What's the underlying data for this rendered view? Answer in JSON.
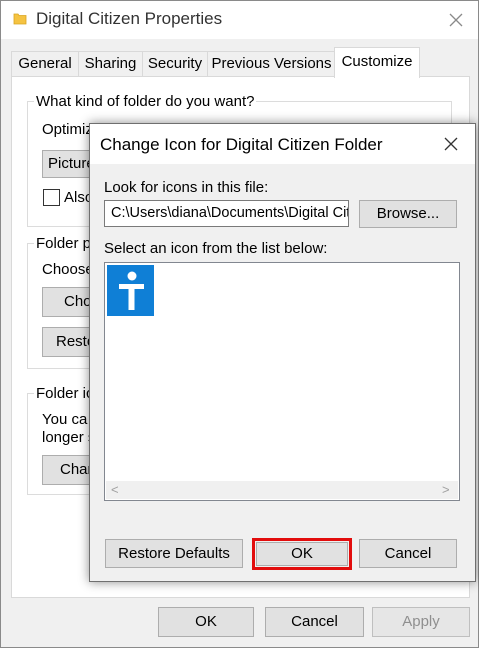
{
  "main_window": {
    "title": "Digital Citizen Properties",
    "close_glyph": "✕",
    "tabs": [
      {
        "label": "General"
      },
      {
        "label": "Sharing"
      },
      {
        "label": "Security"
      },
      {
        "label": "Previous Versions"
      },
      {
        "label": "Customize",
        "active": true
      }
    ],
    "customize": {
      "folder_kind_group": "What kind of folder do you want?",
      "optimize_label": "Optimiz",
      "optimize_value": "Picture",
      "also_label": "Also",
      "folder_pictures_group": "Folder pi",
      "choose_label": "Choose",
      "choose_button": "Cho",
      "restore_button": "Resto",
      "folder_icons_group": "Folder ic",
      "icons_text_1": "You ca",
      "icons_text_2": "longer s",
      "change_button": "Char"
    },
    "buttons": {
      "ok": "OK",
      "cancel": "Cancel",
      "apply": "Apply"
    }
  },
  "dialog": {
    "title": "Change Icon for Digital Citizen Folder",
    "close_glyph": "✕",
    "look_label": "Look for icons in this file:",
    "file_path": "C:\\Users\\diana\\Documents\\Digital Cit",
    "browse_button": "Browse...",
    "select_label": "Select an icon from the list below:",
    "icon_glyph": "i",
    "restore_defaults_button": "Restore Defaults",
    "ok_button": "OK",
    "cancel_button": "Cancel",
    "scroll_left_glyph": "<",
    "scroll_right_glyph": ">"
  },
  "colors": {
    "accent_icon_blue": "#0f7fd6",
    "highlight_red": "#e20d0d",
    "folder_yellow": "#f5c342"
  }
}
